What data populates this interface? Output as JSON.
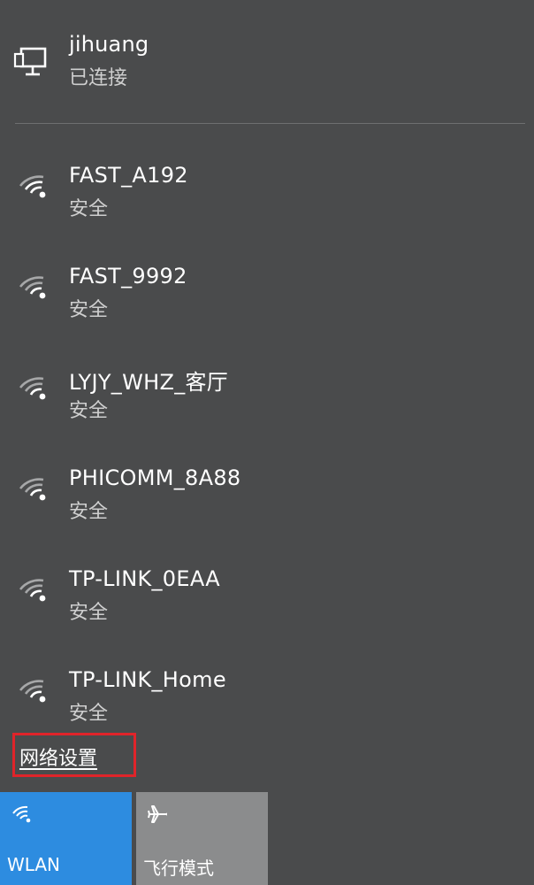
{
  "connected": {
    "name": "jihuang",
    "status": "已连接",
    "icon": "desktop-computer-icon"
  },
  "networks": [
    {
      "ssid": "FAST_A192",
      "security": "安全"
    },
    {
      "ssid": "FAST_9992",
      "security": "安全"
    },
    {
      "ssid": "LYJY_WHZ_客厅",
      "security": "安全"
    },
    {
      "ssid": "PHICOMM_8A88",
      "security": "安全"
    },
    {
      "ssid": "TP-LINK_0EAA",
      "security": "安全"
    },
    {
      "ssid": "TP-LINK_Home",
      "security": "安全"
    }
  ],
  "network_settings_link": "网络设置",
  "quick_actions": [
    {
      "label": "WLAN",
      "icon": "wifi-icon",
      "active": true
    },
    {
      "label": "飞行模式",
      "icon": "airplane-icon",
      "active": false
    }
  ],
  "colors": {
    "background": "#4a4b4c",
    "active_tile": "#2d8ce0",
    "inactive_tile": "#8b8c8d",
    "highlight_box": "#e0242a"
  }
}
